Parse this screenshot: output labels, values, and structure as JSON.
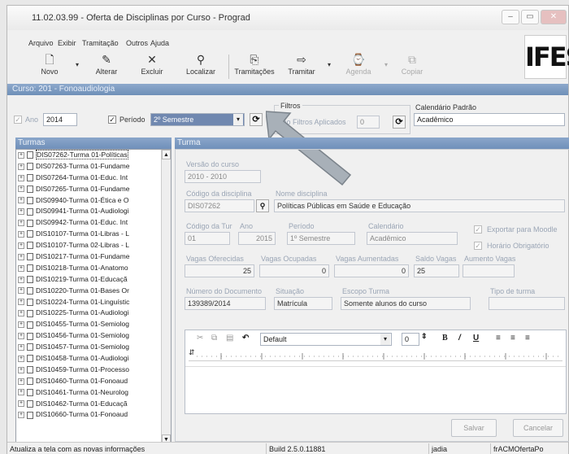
{
  "window": {
    "title": "11.02.03.99 - Oferta de Disciplinas por Curso - Prograd",
    "logo_text": "IFES"
  },
  "menu": [
    "Arquivo",
    "Exibir",
    "Tramitação",
    "Outros",
    "Ajuda"
  ],
  "toolbar": {
    "novo": "Novo",
    "alterar": "Alterar",
    "excluir": "Excluir",
    "localizar": "Localizar",
    "tramitacoes": "Tramitações",
    "tramitar": "Tramitar",
    "agenda": "Agenda",
    "copiar": "Copiar"
  },
  "course_banner": "Curso: 201 - Fonoaudiologia",
  "filters": {
    "ano_label": "Ano",
    "ano_value": "2014",
    "periodo_label": "Período",
    "periodo_value": "2º Semestre",
    "filtros_title": "Filtros",
    "nao_filtros_label": "Não Filtros Aplicados",
    "nao_filtros_value": "0",
    "calendario_label": "Calendário Padrão",
    "calendario_value": "Acadêmico"
  },
  "panels": {
    "turmas": "Turmas",
    "turma": "Turma"
  },
  "turmas": [
    "DIS07262-Turma 01-Políticas",
    "DIS07263-Turma 01-Fundame",
    "DIS07264-Turma 01-Educ. Int",
    "DIS07265-Turma 01-Fundame",
    "DIS09940-Turma 01-Ética e O",
    "DIS09941-Turma 01-Audiologi",
    "DIS09942-Turma 01-Educ. Int",
    "DIS10107-Turma 01-Libras - L",
    "DIS10107-Turma 02-Libras - L",
    "DIS10217-Turma 01-Fundame",
    "DIS10218-Turma 01-Anatomo",
    "DIS10219-Turma 01-Educaçã",
    "DIS10220-Turma 01-Bases Or",
    "DIS10224-Turma 01-Linguístic",
    "DIS10225-Turma 01-Audiologi",
    "DIS10455-Turma 01-Semiolog",
    "DIS10456-Turma 01-Semiolog",
    "DIS10457-Turma 01-Semiolog",
    "DIS10458-Turma 01-Audiologi",
    "DIS10459-Turma 01-Processo",
    "DIS10460-Turma 01-Fonoaud",
    "DIS10461-Turma 01-Neurolog",
    "DIS10462-Turma 01-Educaçã",
    "DIS10660-Turma 01-Fonoaud"
  ],
  "turma": {
    "versao_label": "Versão do curso",
    "versao_value": "2010 - 2010",
    "codigo_label": "Código da disciplina",
    "codigo_value": "DIS07262",
    "nome_label": "Nome disciplina",
    "nome_value": "Políticas Públicas em Saúde e Educação",
    "cod_turma_label": "Código da Tur",
    "cod_turma_value": "01",
    "ano_label": "Ano",
    "ano_value": "2015",
    "periodo_label": "Período",
    "periodo_value": "1º Semestre",
    "calendario_label": "Calendário",
    "calendario_value": "Acadêmico",
    "exportar_label": "Exportar para Moodle",
    "horario_label": "Horário Obrigatório",
    "vagas_oferecidas_label": "Vagas Oferecidas",
    "vagas_oferecidas_value": "25",
    "vagas_ocupadas_label": "Vagas Ocupadas",
    "vagas_ocupadas_value": "0",
    "vagas_aumentadas_label": "Vagas Aumentadas",
    "vagas_aumentadas_value": "0",
    "saldo_label": "Saldo Vagas",
    "saldo_value": "25",
    "aumento_label": "Aumento Vagas",
    "documento_label": "Número do Documento",
    "documento_value": "139389/2014",
    "situacao_label": "Situação",
    "situacao_value": "Matrícula",
    "escopo_label": "Escopo Turma",
    "escopo_value": "Somente alunos do curso",
    "tipo_label": "Tipo de turma"
  },
  "editor": {
    "font_value": "Default",
    "size_value": "0"
  },
  "buttons": {
    "salvar": "Salvar",
    "cancelar": "Cancelar"
  },
  "status": {
    "message": "Atualiza a tela com as novas informações",
    "build": "Build 2.5.0.11881",
    "user": "jadia",
    "form": "frACMOfertaPo"
  }
}
